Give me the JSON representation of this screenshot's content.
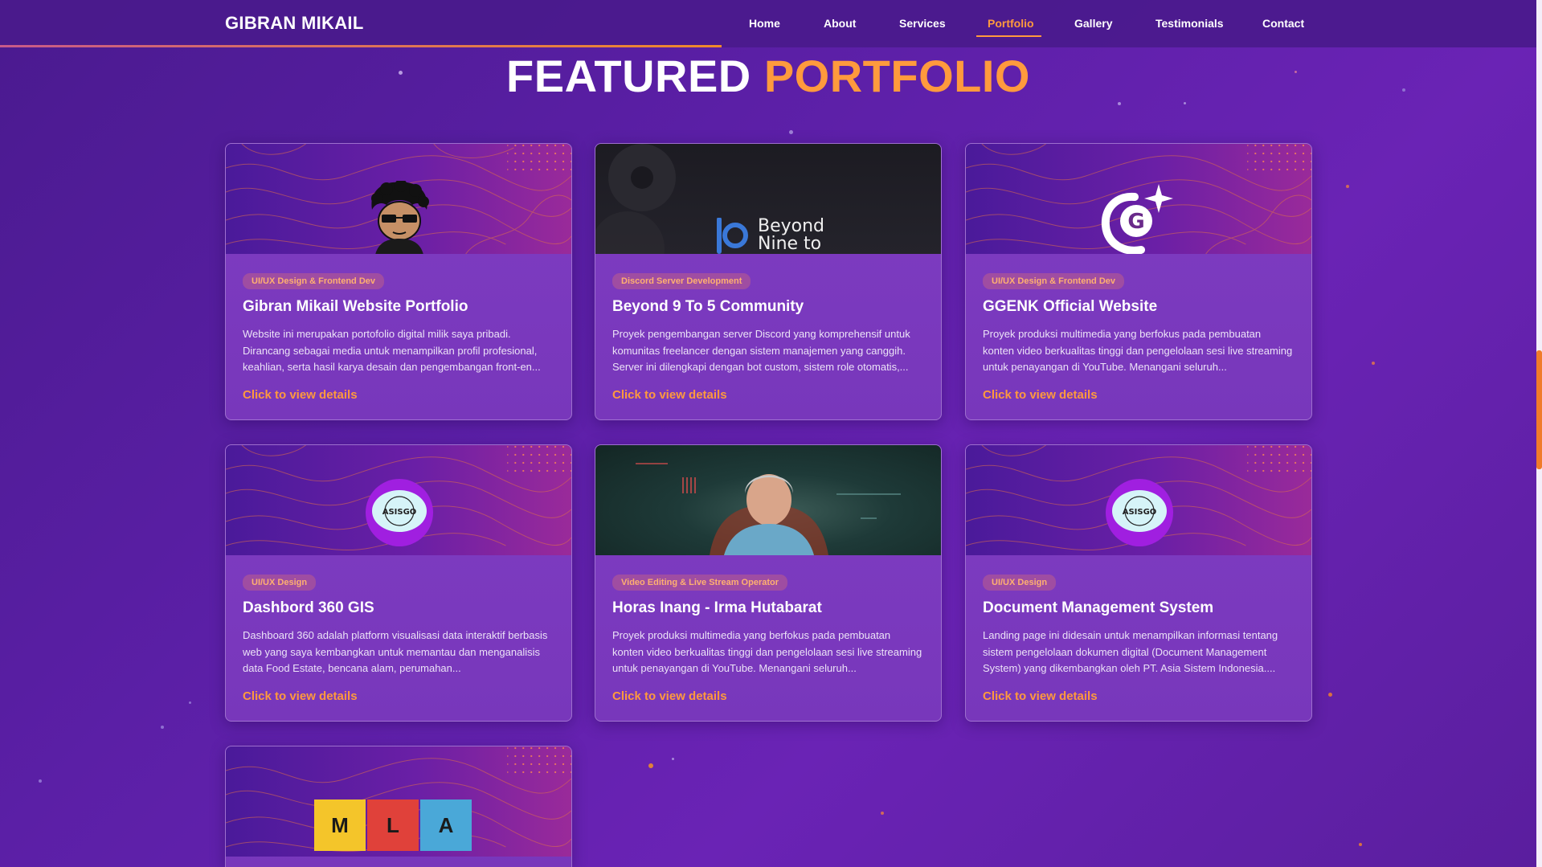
{
  "brand": {
    "name": "GIBRAN MIKAIL"
  },
  "nav": {
    "items": [
      {
        "label": "Home"
      },
      {
        "label": "About"
      },
      {
        "label": "Services"
      },
      {
        "label": "Portfolio",
        "active": true
      },
      {
        "label": "Gallery"
      },
      {
        "label": "Testimonials"
      },
      {
        "label": "Contact"
      }
    ]
  },
  "section": {
    "title_main": "FEATURED",
    "title_accent": "PORTFOLIO"
  },
  "colors": {
    "accent": "#ff9a3d",
    "background": "#5b1fa6",
    "card": "#7e3cc2"
  },
  "projects": [
    {
      "badge": "UI/UX Design & Frontend Dev",
      "title": "Gibran Mikail Website Portfolio",
      "description": "Website ini merupakan portofolio digital milik saya pribadi. Dirancang sebagai media untuk menampilkan profil profesional, keahlian, serta hasil karya desain dan pengembangan front-en...",
      "link": "Click to view details",
      "image": "cartoon-avatar-icon"
    },
    {
      "badge": "Discord Server Development",
      "title": "Beyond 9 To 5 Community",
      "description": "Proyek pengembangan server Discord yang komprehensif untuk komunitas freelancer dengan sistem manajemen yang canggih. Server ini dilengkapi dengan bot custom, sistem role otomatis,...",
      "link": "Click to view details",
      "image": "beyond-nine-logo",
      "image_text_1": "Beyond",
      "image_text_2": "Nine to"
    },
    {
      "badge": "UI/UX Design & Frontend Dev",
      "title": "GGENK Official Website",
      "description": "Proyek produksi multimedia yang berfokus pada pembuatan konten video berkualitas tinggi dan pengelolaan sesi live streaming untuk penayangan di YouTube. Menangani seluruh...",
      "link": "Click to view details",
      "image": "ggenk-logo"
    },
    {
      "badge": "UI/UX Design",
      "title": "Dashbord 360 GIS",
      "description": "Dashboard 360 adalah platform visualisasi data interaktif berbasis web yang saya kembangkan untuk memantau dan menganalisis data Food Estate, bencana alam, perumahan...",
      "link": "Click to view details",
      "image": "asisgo-logo",
      "image_text": "ASISGO"
    },
    {
      "badge": "Video Editing & Live Stream Operator",
      "title": "Horas Inang - Irma Hutabarat",
      "description": "Proyek produksi multimedia yang berfokus pada pembuatan konten video berkualitas tinggi dan pengelolaan sesi live streaming untuk penayangan di YouTube. Menangani seluruh...",
      "link": "Click to view details",
      "image": "host-photo"
    },
    {
      "badge": "UI/UX Design",
      "title": "Document Management System",
      "description": "Landing page ini didesain untuk menampilkan informasi tentang sistem pengelolaan dokumen digital (Document Management System) yang dikembangkan oleh PT. Asia Sistem Indonesia....",
      "link": "Click to view details",
      "image": "asisgo-logo",
      "image_text": "ASISGO"
    },
    {
      "image": "mla-logo",
      "image_letters": [
        "M",
        "L",
        "A"
      ]
    }
  ]
}
